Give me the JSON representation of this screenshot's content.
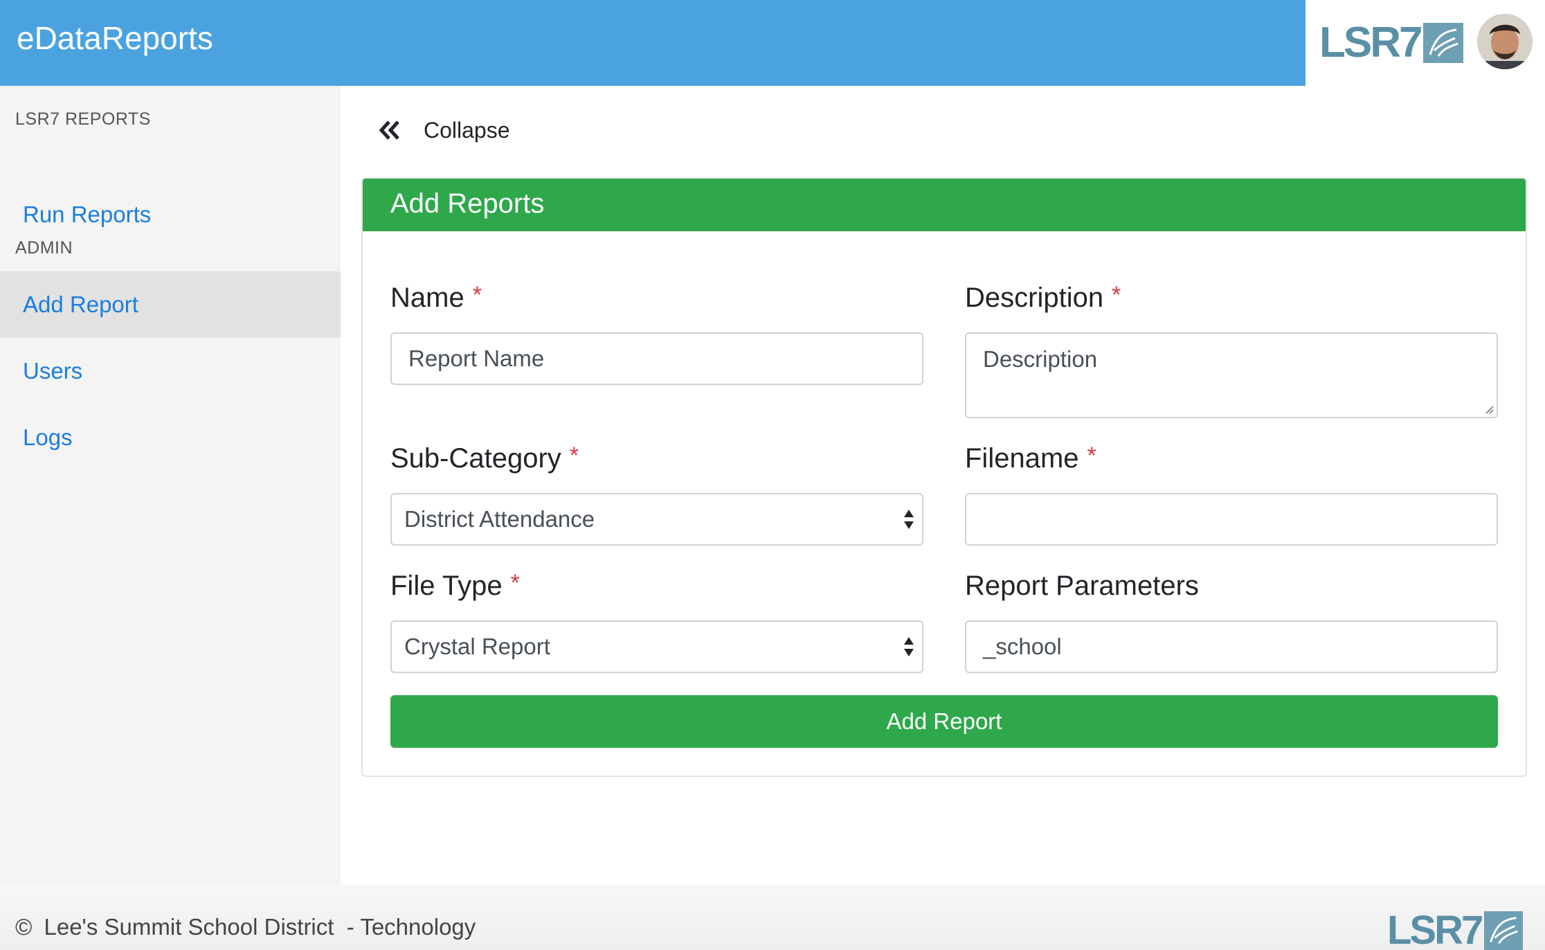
{
  "header": {
    "brand": "eDataReports",
    "logo_text": "LSR7",
    "avatar_icon": "user-avatar",
    "colors": {
      "bar": "#4aa3df",
      "logo": "#5a8fa6"
    }
  },
  "sidebar": {
    "sections": [
      {
        "heading": "LSR7 REPORTS",
        "items": [
          {
            "label": "Run Reports",
            "active": false
          }
        ]
      },
      {
        "heading": "ADMIN",
        "items": [
          {
            "label": "Add Report",
            "active": true
          },
          {
            "label": "Users",
            "active": false
          },
          {
            "label": "Logs",
            "active": false
          }
        ]
      }
    ]
  },
  "main": {
    "collapse": {
      "icon": "double-chevron-left-icon",
      "label": "Collapse"
    },
    "card": {
      "title": "Add Reports",
      "color": "#2ea84a",
      "fields": {
        "name": {
          "label": "Name",
          "required_mark": "*",
          "value": "",
          "placeholder": "Report Name"
        },
        "description": {
          "label": "Description",
          "required_mark": "*",
          "value": "",
          "placeholder": "Description"
        },
        "subcategory": {
          "label": "Sub-Category",
          "required_mark": "*",
          "selected": "District Attendance"
        },
        "filename": {
          "label": "Filename",
          "required_mark": "*",
          "value": ""
        },
        "filetype": {
          "label": "File Type",
          "required_mark": "*",
          "selected": "Crystal Report"
        },
        "parameters": {
          "label": "Report Parameters",
          "value": "_school"
        }
      },
      "submit_label": "Add Report"
    }
  },
  "footer": {
    "copyright_symbol": "©",
    "text": "Lee's Summit School District  - Technology",
    "logo_text": "LSR7"
  }
}
